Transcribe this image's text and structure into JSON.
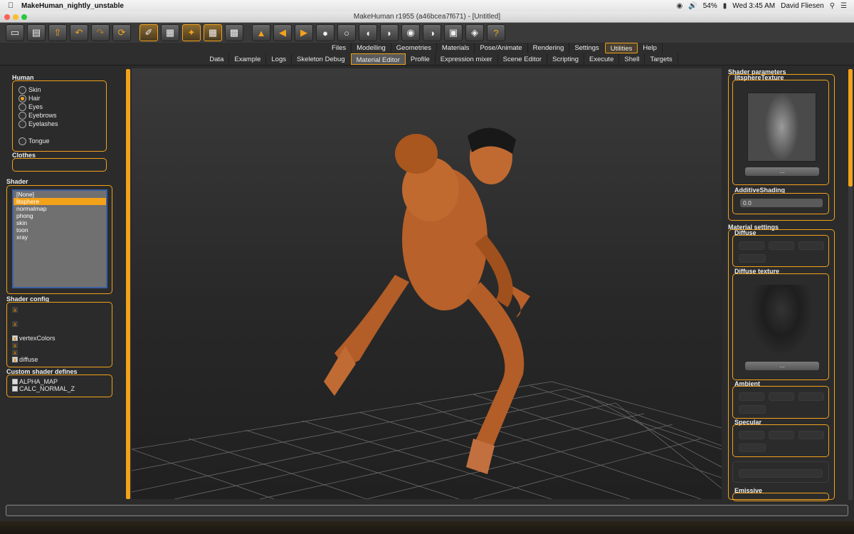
{
  "menubar": {
    "app_name": "MakeHuman_nightly_unstable",
    "battery": "54%",
    "clock": "Wed 3:45 AM",
    "user": "David Fliesen"
  },
  "window": {
    "title": "MakeHuman r1955 (a46bcea7f671) - [Untitled]"
  },
  "main_tabs": [
    "Files",
    "Modelling",
    "Geometries",
    "Materials",
    "Pose/Animate",
    "Rendering",
    "Settings",
    "Utilities",
    "Help"
  ],
  "main_tab_active": "Utilities",
  "sub_tabs": [
    "Data",
    "Example",
    "Logs",
    "Skeleton Debug",
    "Material Editor",
    "Profile",
    "Expression mixer",
    "Scene Editor",
    "Scripting",
    "Execute",
    "Shell",
    "Targets"
  ],
  "sub_tab_active": "Material Editor",
  "left": {
    "human_title": "Human",
    "human_items": [
      {
        "label": "Skin",
        "selected": false
      },
      {
        "label": "Hair",
        "selected": true
      },
      {
        "label": "Eyes",
        "selected": false
      },
      {
        "label": "Eyebrows",
        "selected": false
      },
      {
        "label": "Eyelashes",
        "selected": false
      },
      {
        "label": "Tongue",
        "selected": false
      }
    ],
    "clothes_title": "Clothes",
    "shader_title": "Shader",
    "shader_list": [
      "[None]",
      "litsphere",
      "normalmap",
      "phong",
      "skin",
      "toon",
      "xray"
    ],
    "shader_selected": "litsphere",
    "shader_config_title": "Shader config",
    "shader_config": [
      {
        "label": "vertexColors",
        "checked": true,
        "enabled": true
      },
      {
        "label": "diffuse",
        "checked": true,
        "enabled": true
      }
    ],
    "custom_defines_title": "Custom shader defines",
    "custom_defines": [
      "ALPHA_MAP",
      "CALC_NORMAL_Z"
    ]
  },
  "right": {
    "shader_params_title": "Shader parameters",
    "litsphere_title": "litsphereTexture",
    "litsphere_button": "...",
    "additive_title": "AdditiveShading",
    "additive_value": "0.0",
    "material_settings_title": "Material settings",
    "diffuse_title": "Diffuse",
    "diffuse_texture_title": "Diffuse texture",
    "diffuse_texture_button": "...",
    "ambient_title": "Ambient",
    "specular_title": "Specular",
    "emissive_title": "Emissive"
  },
  "colors": {
    "accent": "#f3a21a",
    "panel": "#2b2b2b",
    "viewport_top": "#3a3a3a"
  }
}
